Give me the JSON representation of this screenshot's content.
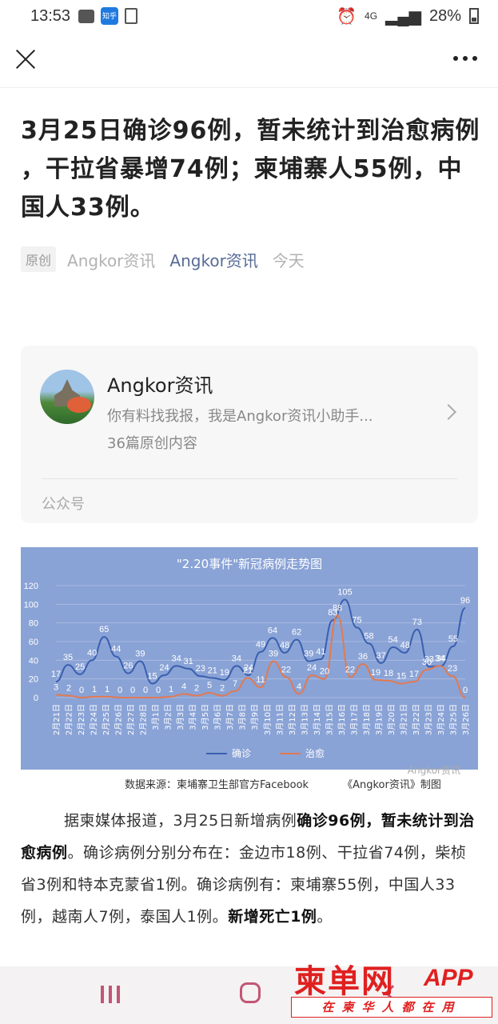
{
  "status_bar": {
    "time": "13:53",
    "zhihu_badge": "知乎",
    "network": "4G",
    "battery": "28%"
  },
  "article": {
    "title": "3月25日确诊96例，暂未统计到治愈病例 ，干拉省暴增74例；柬埔寨人55例，中国人33例。",
    "tag": "原创",
    "author": "Angkor资讯",
    "account": "Angkor资讯",
    "date": "今天"
  },
  "profile_card": {
    "name": "Angkor资讯",
    "description": "你有料找我报，我是Angkor资讯小助手...",
    "count": "36篇原创内容",
    "type": "公众号"
  },
  "chart_caption": {
    "source": "数据来源：柬埔寨卫生部官方Facebook",
    "made_by": "《Angkor资讯》制图",
    "watermark": "Angkor资讯"
  },
  "chart_data": {
    "type": "line",
    "title": "\"2.20事件\"新冠病例走势图",
    "categories": [
      "2月21日",
      "2月22日",
      "2月23日",
      "2月24日",
      "2月25日",
      "2月26日",
      "2月27日",
      "2月28日",
      "3月1日",
      "3月2日",
      "3月3日",
      "3月4日",
      "3月5日",
      "3月6日",
      "3月7日",
      "3月8日",
      "3月9日",
      "3月10日",
      "3月11日",
      "3月12日",
      "3月13日",
      "3月14日",
      "3月15日",
      "3月16日",
      "3月17日",
      "3月18日",
      "3月19日",
      "3月20日",
      "3月21日",
      "3月22日",
      "3月23日",
      "3月24日",
      "3月25日",
      "3月26日"
    ],
    "series": [
      {
        "name": "确诊",
        "color": "#3a5fb0",
        "values": [
          17,
          35,
          25,
          40,
          65,
          44,
          26,
          39,
          15,
          24,
          34,
          31,
          23,
          21,
          19,
          34,
          24,
          49,
          64,
          48,
          62,
          39,
          41,
          83,
          105,
          75,
          58,
          37,
          54,
          48,
          73,
          33,
          34,
          55,
          96
        ]
      },
      {
        "name": "治愈",
        "color": "#e07a52",
        "values": [
          3,
          2,
          0,
          1,
          1,
          0,
          0,
          0,
          0,
          1,
          4,
          2,
          5,
          2,
          7,
          21,
          11,
          39,
          22,
          4,
          24,
          20,
          88,
          22,
          36,
          19,
          18,
          15,
          17,
          30,
          34,
          23,
          0
        ]
      }
    ],
    "y_ticks": [
      "0",
      "20",
      "40",
      "60",
      "80",
      "100",
      "120"
    ],
    "ylim": [
      0,
      120
    ],
    "legend": "bottom-center"
  },
  "body": {
    "p1_a": "据柬媒体报道，3月25日新增病例",
    "p1_b": "确诊96例",
    "p1_c": "，",
    "p1_d": "暂未统计到治愈病例",
    "p1_e": "。确诊病例分别分布在：金边市18例、干拉省74例，柴桢省3例和特本克蒙省1例。确诊病例有：柬埔寨55例，中国人33例，越南人7例，泰国人1例。",
    "p1_f": "新增死亡1例",
    "p1_g": "。"
  },
  "watermark_logo": {
    "main": "柬单网",
    "app": "APP",
    "slogan": "在柬华人都在用"
  }
}
